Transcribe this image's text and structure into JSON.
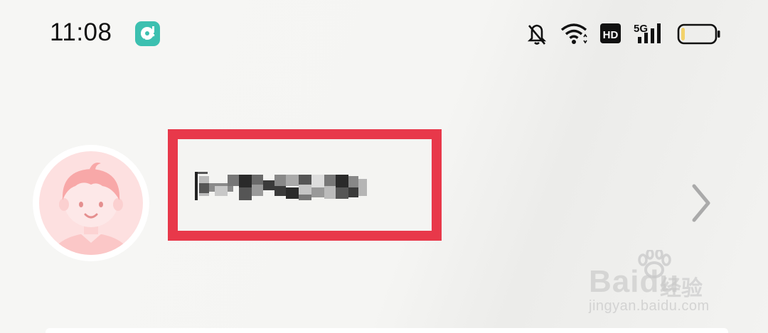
{
  "status_bar": {
    "time": "11:08",
    "app_notification_icon": "music-app-icon",
    "icons": [
      "bell-muted-icon",
      "wifi-icon",
      "hd-icon",
      "cellular-5g-icon",
      "battery-icon"
    ],
    "hd_label": "HD",
    "network_label": "5G",
    "battery_level": 0.12,
    "app_icon_color": "#3cc0b0"
  },
  "profile": {
    "avatar_icon": "boy-avatar-icon",
    "name": "",
    "name_obscured": true,
    "chevron_icon": "chevron-right-icon"
  },
  "highlight": {
    "color": "#e8384a"
  },
  "watermark": {
    "brand": "Bai",
    "brand_suffix": "du",
    "cn_text": "经验",
    "url": "jingyan.baidu.com"
  }
}
